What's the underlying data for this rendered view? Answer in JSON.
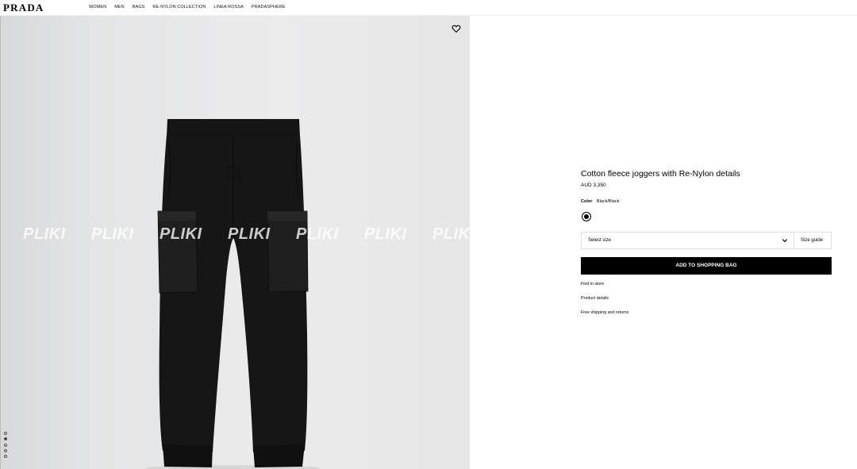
{
  "header": {
    "brand": "PRADA",
    "nav": [
      "WOMEN",
      "MEN",
      "BAGS",
      "RE-NYLON COLLECTION",
      "LINEA ROSSA",
      "PRADASPHERE"
    ]
  },
  "gallery": {
    "watermark_text": "PLIKI",
    "watermarks": [
      "PLIKI",
      "PLIKI",
      "PLIKI",
      "PLIKI",
      "PLIKI",
      "PLIKI",
      "PLIKI"
    ],
    "slide_count": 5,
    "active_slide": 2,
    "wishlist_icon": "heart-icon"
  },
  "product": {
    "title": "Cotton fleece joggers with Re-Nylon details",
    "price": "AUD 3,350",
    "color_label": "Color",
    "color_value": "Black/Black",
    "swatch_color": "#000000",
    "size_placeholder": "Select size",
    "size_guide": "Size guide",
    "add_to_bag": "ADD TO SHOPPING BAG",
    "links": [
      "Find in store",
      "Product details",
      "Free shipping and returns"
    ]
  }
}
